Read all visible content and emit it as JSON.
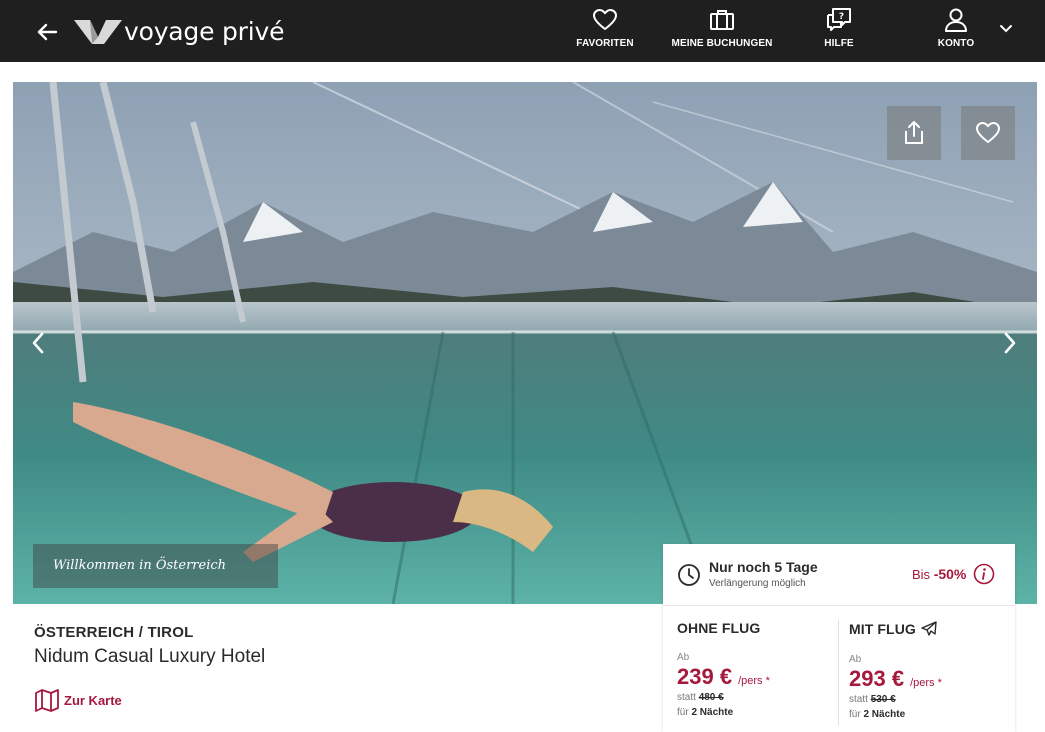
{
  "nav": {
    "brand": "voyage privé",
    "items": [
      {
        "label": "FAVORITEN",
        "icon": "heart-icon"
      },
      {
        "label": "MEINE BUCHUNGEN",
        "icon": "suitcase-icon"
      },
      {
        "label": "HILFE",
        "icon": "help-chat-icon"
      },
      {
        "label": "KONTO",
        "icon": "user-icon"
      }
    ]
  },
  "hero": {
    "caption": "Willkommen in Österreich"
  },
  "listing": {
    "region": "ÖSTERREICH / TIROL",
    "hotel": "Nidum Casual Luxury Hotel",
    "map_link": "Zur Karte"
  },
  "offer": {
    "countdown": "Nur noch 5 Tage",
    "extension": "Verlängerung möglich",
    "discount_prefix": "Bis",
    "discount_value": "-50%",
    "without_flight": {
      "title": "OHNE FLUG",
      "from": "Ab",
      "price": "239 €",
      "per": "/pers *",
      "instead_label": "statt",
      "old_price": "480 €",
      "for_label": "für",
      "nights": "2 Nächte"
    },
    "with_flight": {
      "title": "MIT FLUG",
      "from": "Ab",
      "price": "293 €",
      "per": "/pers *",
      "instead_label": "statt",
      "old_price": "530 €",
      "for_label": "für",
      "nights": "2 Nächte"
    }
  },
  "colors": {
    "topbar": "#1f1f1f",
    "accent": "#a6193d",
    "text": "#2b2b2b"
  }
}
